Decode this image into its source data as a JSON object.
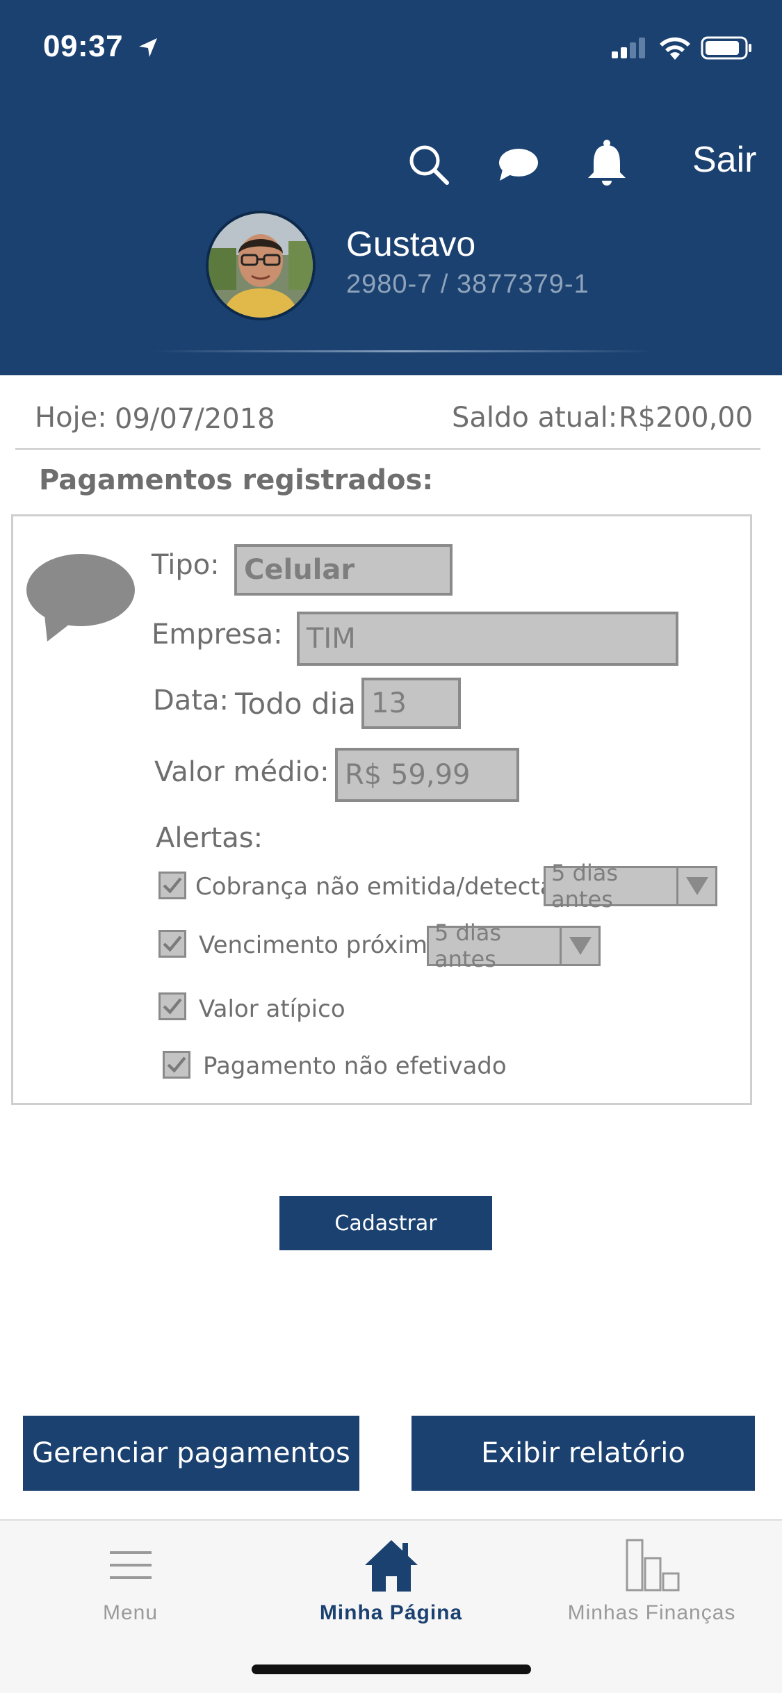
{
  "status_bar": {
    "time": "09:37"
  },
  "header": {
    "logout_label": "Sair",
    "user_name": "Gustavo",
    "account": "2980-7 / 3877379-1",
    "icons": [
      "search-icon",
      "chat-icon",
      "bell-icon"
    ]
  },
  "info": {
    "today_label": "Hoje:",
    "today_value": "09/07/2018",
    "balance_label": "Saldo atual:",
    "balance_value": "R$200,00"
  },
  "section_title": "Pagamentos registrados:",
  "payment": {
    "tipo_label": "Tipo:",
    "tipo_value": "Celular",
    "empresa_label": "Empresa:",
    "empresa_value": "TIM",
    "data_label": "Data:",
    "data_prefix": "Todo dia",
    "data_value": "13",
    "valor_label": "Valor médio:",
    "valor_value": "R$ 59,99",
    "alertas_label": "Alertas:",
    "alerts": [
      {
        "label": "Cobrança não emitida/detectada",
        "checked": true,
        "select": "5 dias antes"
      },
      {
        "label": "Vencimento próximo",
        "checked": true,
        "select": "5 dias antes"
      },
      {
        "label": "Valor atípico",
        "checked": true
      },
      {
        "label": "Pagamento não efetivado",
        "checked": true
      }
    ]
  },
  "buttons": {
    "register": "Cadastrar",
    "manage": "Gerenciar pagamentos",
    "report": "Exibir relatório"
  },
  "tabbar": {
    "tabs": [
      {
        "label": "Menu",
        "icon": "hamburger-icon",
        "active": false
      },
      {
        "label": "Minha Página",
        "icon": "home-icon",
        "active": true
      },
      {
        "label": "Minhas Finanças",
        "icon": "bar-chart-icon",
        "active": false
      }
    ]
  },
  "colors": {
    "brand": "#1b4170",
    "field_bg": "#c4c4c4",
    "text_gray": "#6e6e6e"
  }
}
